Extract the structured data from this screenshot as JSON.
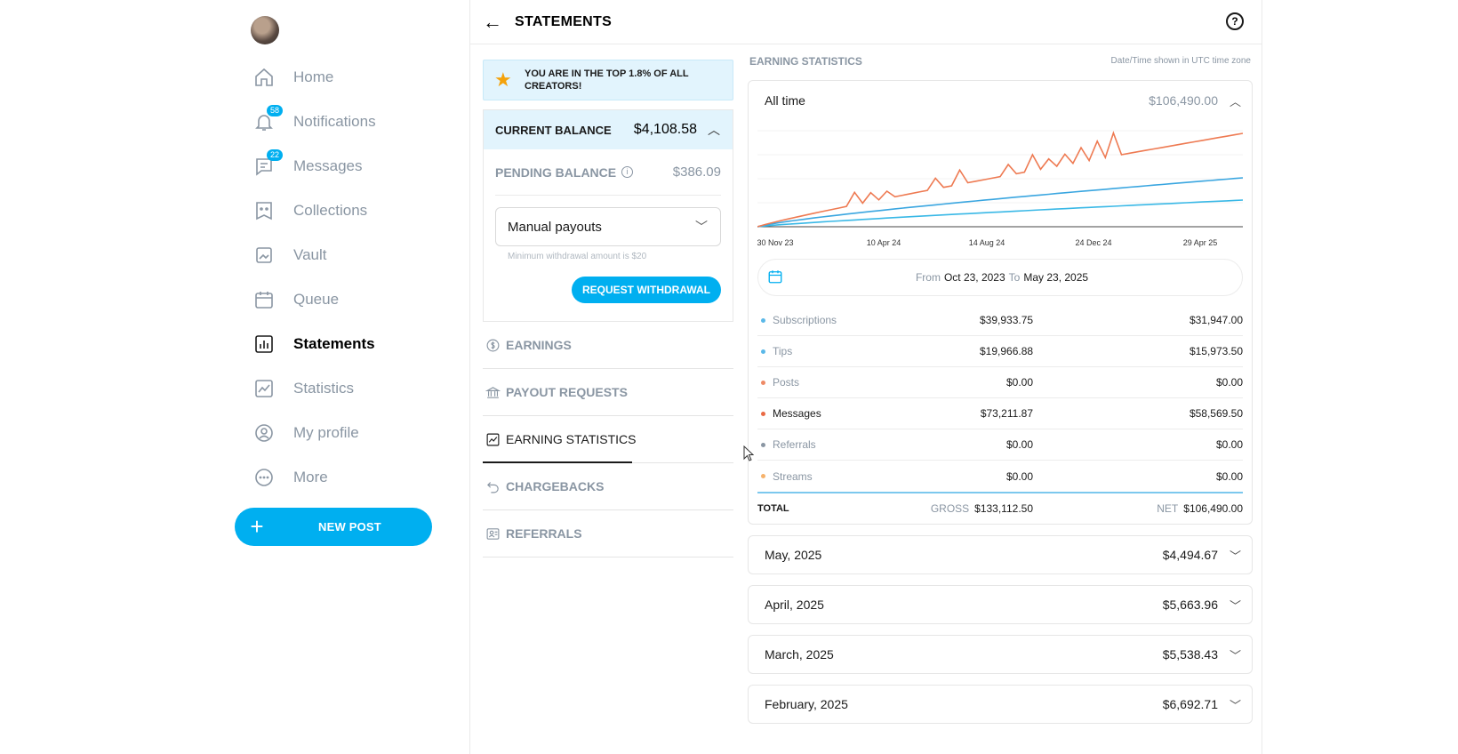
{
  "sidebar": {
    "items": [
      {
        "label": "Home",
        "icon": "home-icon"
      },
      {
        "label": "Notifications",
        "icon": "bell-icon",
        "badge": "58"
      },
      {
        "label": "Messages",
        "icon": "message-icon",
        "badge": "22"
      },
      {
        "label": "Collections",
        "icon": "collections-icon"
      },
      {
        "label": "Vault",
        "icon": "vault-icon"
      },
      {
        "label": "Queue",
        "icon": "calendar-icon"
      },
      {
        "label": "Statements",
        "icon": "statements-icon",
        "active": true
      },
      {
        "label": "Statistics",
        "icon": "statistics-icon"
      },
      {
        "label": "My profile",
        "icon": "profile-icon"
      },
      {
        "label": "More",
        "icon": "more-icon"
      }
    ],
    "new_post_label": "NEW POST"
  },
  "header": {
    "title": "STATEMENTS"
  },
  "left": {
    "banner": "YOU ARE IN THE TOP 1.8% OF ALL CREATORS!",
    "current_balance_label": "CURRENT BALANCE",
    "current_balance_value": "$4,108.58",
    "pending_balance_label": "PENDING BALANCE",
    "pending_balance_value": "$386.09",
    "payout_select": "Manual payouts",
    "min_note": "Minimum withdrawal amount is $20",
    "withdraw_label": "REQUEST WITHDRAWAL",
    "tabs": [
      {
        "label": "EARNINGS",
        "icon": "dollar-icon"
      },
      {
        "label": "PAYOUT REQUESTS",
        "icon": "bank-icon"
      },
      {
        "label": "EARNING STATISTICS",
        "icon": "chart-icon",
        "active": true
      },
      {
        "label": "CHARGEBACKS",
        "icon": "undo-icon"
      },
      {
        "label": "REFERRALS",
        "icon": "referral-icon"
      }
    ]
  },
  "right": {
    "section_title": "EARNING STATISTICS",
    "timezone_note": "Date/Time shown in UTC time zone",
    "all_time_label": "All time",
    "all_time_value": "$106,490.00",
    "chart_ticks": [
      "30 Nov 23",
      "10 Apr 24",
      "14 Aug 24",
      "24 Dec 24",
      "29 Apr 25"
    ],
    "range": {
      "from_label": "From",
      "from": "Oct 23, 2023",
      "to_label": "To",
      "to": "May 23, 2025"
    },
    "rows": [
      {
        "name": "Subscriptions",
        "gross": "$39,933.75",
        "net": "$31,947.00",
        "color": "#5ab8e8",
        "dark": false
      },
      {
        "name": "Tips",
        "gross": "$19,966.88",
        "net": "$15,973.50",
        "color": "#5ab8e8",
        "dark": false
      },
      {
        "name": "Posts",
        "gross": "$0.00",
        "net": "$0.00",
        "color": "#ee8a66",
        "dark": false
      },
      {
        "name": "Messages",
        "gross": "$73,211.87",
        "net": "$58,569.50",
        "color": "#e96a45",
        "dark": true
      },
      {
        "name": "Referrals",
        "gross": "$0.00",
        "net": "$0.00",
        "color": "#8a96a3",
        "dark": false
      },
      {
        "name": "Streams",
        "gross": "$0.00",
        "net": "$0.00",
        "color": "#f6b26b",
        "dark": false
      }
    ],
    "total": {
      "label": "TOTAL",
      "gross_label": "GROSS",
      "gross": "$133,112.50",
      "net_label": "NET",
      "net": "$106,490.00"
    },
    "months": [
      {
        "label": "May, 2025",
        "value": "$4,494.67"
      },
      {
        "label": "April, 2025",
        "value": "$5,663.96"
      },
      {
        "label": "March, 2025",
        "value": "$5,538.43"
      },
      {
        "label": "February, 2025",
        "value": "$6,692.71"
      }
    ]
  },
  "colors": {
    "accent": "#00aff0",
    "orange_line": "#ee7a52",
    "blue_line": "#3aa6e0",
    "cyan_line": "#39b8e6"
  }
}
